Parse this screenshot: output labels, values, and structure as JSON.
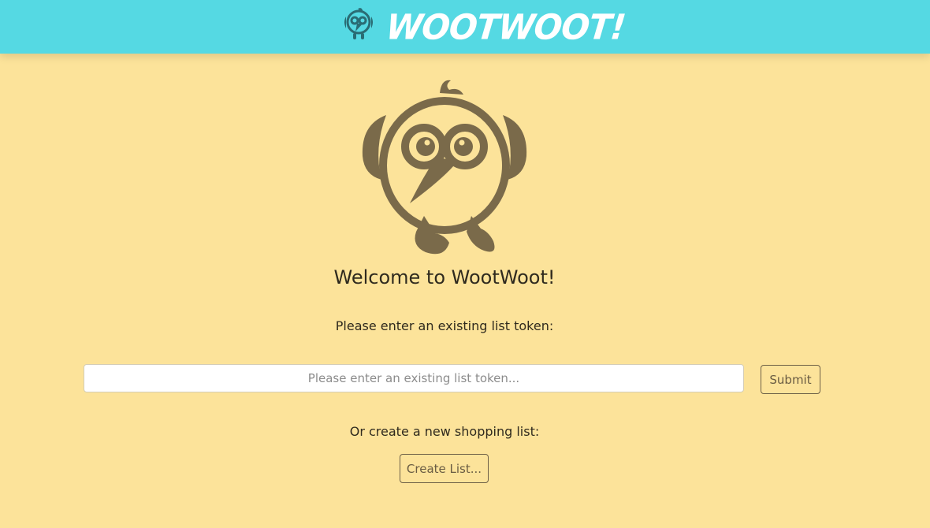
{
  "header": {
    "brand": "WOOTWOOT!",
    "logo_icon": "owl-logo-icon",
    "background_color": "#55d9e3"
  },
  "main": {
    "mascot_icon": "owl-mascot-icon",
    "welcome": "Welcome to WootWoot!",
    "existing_prompt": "Please enter an existing list token:",
    "token_input": {
      "value": "",
      "placeholder": "Please enter an existing list token..."
    },
    "submit_label": "Submit",
    "create_prompt": "Or create a new shopping list:",
    "create_label": "Create List..."
  },
  "colors": {
    "page_background": "#fce39a",
    "mascot": "#7a6a4a",
    "logo": "#2a6c74"
  }
}
